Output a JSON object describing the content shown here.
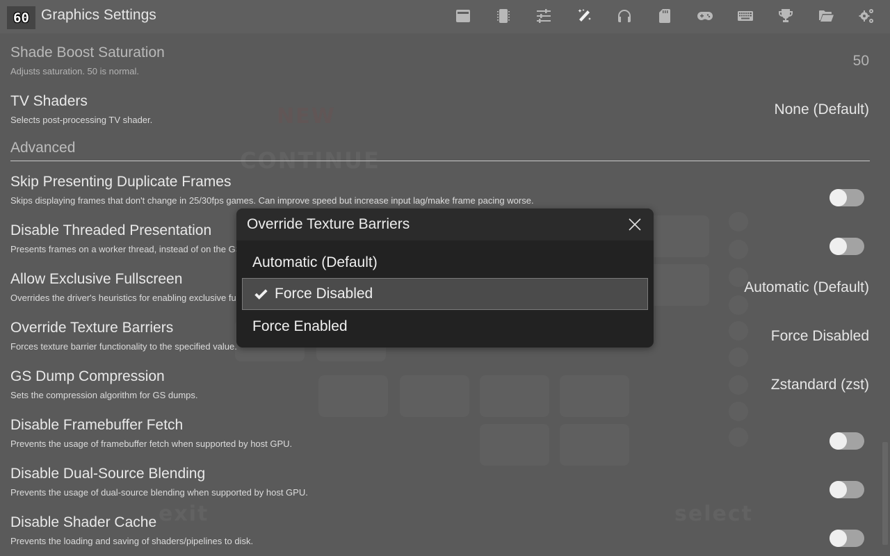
{
  "header": {
    "fps": "60",
    "title": "Graphics Settings",
    "nav_icons": [
      {
        "name": "summary-icon",
        "active": false
      },
      {
        "name": "chip-icon",
        "active": false
      },
      {
        "name": "sliders-icon",
        "active": false
      },
      {
        "name": "magic-wand-icon",
        "active": true
      },
      {
        "name": "headphones-icon",
        "active": false
      },
      {
        "name": "memory-card-icon",
        "active": false
      },
      {
        "name": "gamepad-icon",
        "active": false
      },
      {
        "name": "keyboard-icon",
        "active": false
      },
      {
        "name": "trophy-icon",
        "active": false
      },
      {
        "name": "folder-open-icon",
        "active": false
      },
      {
        "name": "gears-icon",
        "active": false
      }
    ]
  },
  "background": {
    "ghost_new": "NEW",
    "ghost_continue": "CONTINUE",
    "ghost_exit": "exit",
    "ghost_select": "select"
  },
  "settings": {
    "shade_boost_saturation": {
      "title": "Shade Boost Saturation",
      "desc": "Adjusts saturation. 50 is normal.",
      "value": "50"
    },
    "tv_shaders": {
      "title": "TV Shaders",
      "desc": "Selects post-processing TV shader.",
      "value": "None (Default)"
    },
    "advanced_header": "Advanced",
    "skip_duplicate_frames": {
      "title": "Skip Presenting Duplicate Frames",
      "desc": "Skips displaying frames that don't change in 25/30fps games. Can improve speed but increase input lag/make frame pacing worse.",
      "enabled": false
    },
    "disable_threaded_presentation": {
      "title": "Disable Threaded Presentation",
      "desc": "Presents frames on a worker thread, instead of on the GS thread. Can improve frame times on some systems, at the cost of potentially worse frame pacing.",
      "enabled": false
    },
    "allow_exclusive_fullscreen": {
      "title": "Allow Exclusive Fullscreen",
      "desc": "Overrides the driver's heuristics for enabling exclusive fullscreen, or direct flip/scanout.",
      "value": "Automatic (Default)"
    },
    "override_texture_barriers": {
      "title": "Override Texture Barriers",
      "desc": "Forces texture barrier functionality to the specified value.",
      "value": "Force Disabled"
    },
    "gs_dump_compression": {
      "title": "GS Dump Compression",
      "desc": "Sets the compression algorithm for GS dumps.",
      "value": "Zstandard (zst)"
    },
    "disable_framebuffer_fetch": {
      "title": "Disable Framebuffer Fetch",
      "desc": "Prevents the usage of framebuffer fetch when supported by host GPU.",
      "enabled": false
    },
    "disable_dual_source_blending": {
      "title": "Disable Dual-Source Blending",
      "desc": "Prevents the usage of dual-source blending when supported by host GPU.",
      "enabled": false
    },
    "disable_shader_cache": {
      "title": "Disable Shader Cache",
      "desc": "Prevents the loading and saving of shaders/pipelines to disk.",
      "enabled": false
    }
  },
  "dialog": {
    "title": "Override Texture Barriers",
    "close_icon": "close-icon",
    "options": [
      {
        "label": "Automatic (Default)",
        "selected": false
      },
      {
        "label": "Force Disabled",
        "selected": true
      },
      {
        "label": "Force Enabled",
        "selected": false
      }
    ]
  }
}
